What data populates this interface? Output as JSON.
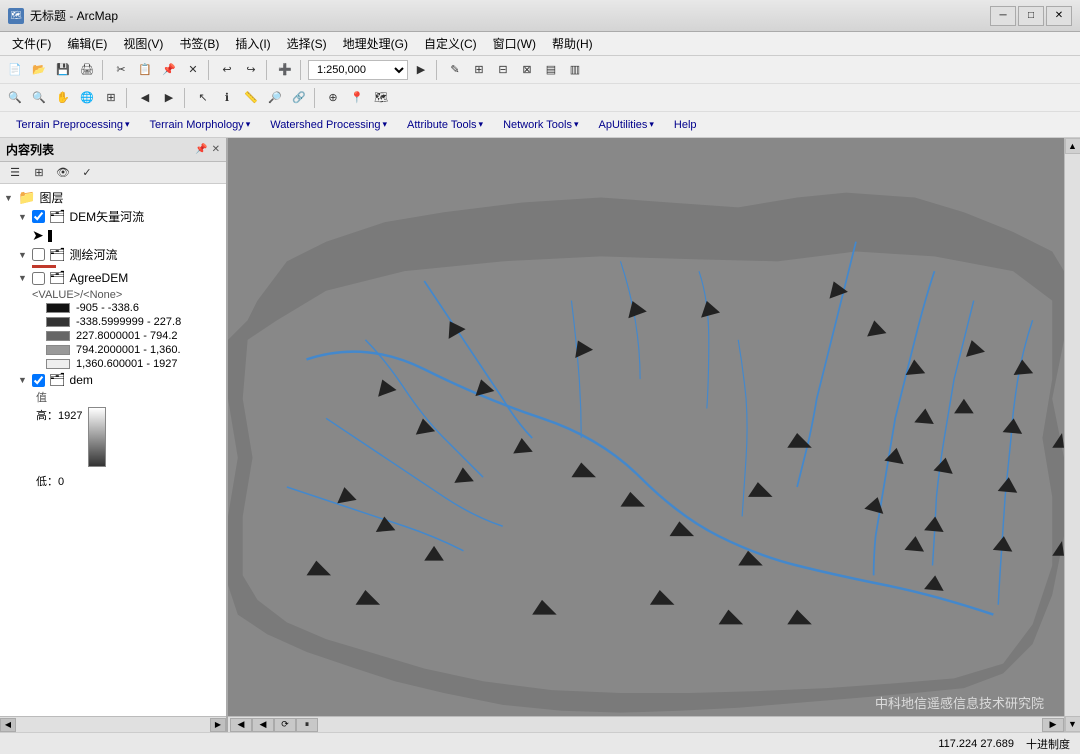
{
  "titleBar": {
    "icon": "🗺",
    "title": "无标题 - ArcMap",
    "minimize": "─",
    "maximize": "□",
    "close": "✕"
  },
  "menuBar": {
    "items": [
      "文件(F)",
      "编辑(E)",
      "视图(V)",
      "书签(B)",
      "插入(I)",
      "选择(S)",
      "地理处理(G)",
      "自定义(C)",
      "窗口(W)",
      "帮助(H)"
    ]
  },
  "toolbar1": {
    "scale": "1:250,000"
  },
  "pluginToolbar": {
    "items": [
      {
        "label": "Terrain Preprocessing",
        "arrow": "▾"
      },
      {
        "label": "Terrain Morphology",
        "arrow": "▾"
      },
      {
        "label": "Watershed Processing",
        "arrow": "▾"
      },
      {
        "label": "Attribute Tools",
        "arrow": "▾"
      },
      {
        "label": "Network Tools",
        "arrow": "▾"
      },
      {
        "label": "ApUtilities",
        "arrow": "▾"
      },
      {
        "label": "Help"
      }
    ]
  },
  "toc": {
    "title": "内容列表",
    "rootLabel": "图层",
    "layers": [
      {
        "name": "DEM矢量河流",
        "checked": true,
        "type": "line",
        "legendColor": "#000",
        "indent": 1
      },
      {
        "name": "测绘河流",
        "checked": false,
        "type": "line",
        "legendColor": "#c0392b",
        "indent": 1
      },
      {
        "name": "AgreeDEM",
        "checked": false,
        "type": "raster",
        "indent": 1,
        "sublabel": "<VALUE>/<None>",
        "legend": [
          {
            "range": "-905 - -338.6",
            "color": "#111"
          },
          {
            "range": "-338.5999999 - 227.8",
            "color": "#333"
          },
          {
            "range": "227.8000001 - 794.2",
            "color": "#666"
          },
          {
            "range": "794.2000001 - 1,360.",
            "color": "#999"
          },
          {
            "range": "1,360.600001 - 1927",
            "color": "#eee"
          }
        ]
      },
      {
        "name": "dem",
        "checked": true,
        "type": "raster",
        "indent": 1,
        "valueLabel": "值",
        "highLabel": "高：1927",
        "lowLabel": "低：0"
      }
    ]
  },
  "statusBar": {
    "coords": "117.224  27.689",
    "unit": "十进制度"
  },
  "watermark": "中科地信遥感信息技术研究院"
}
